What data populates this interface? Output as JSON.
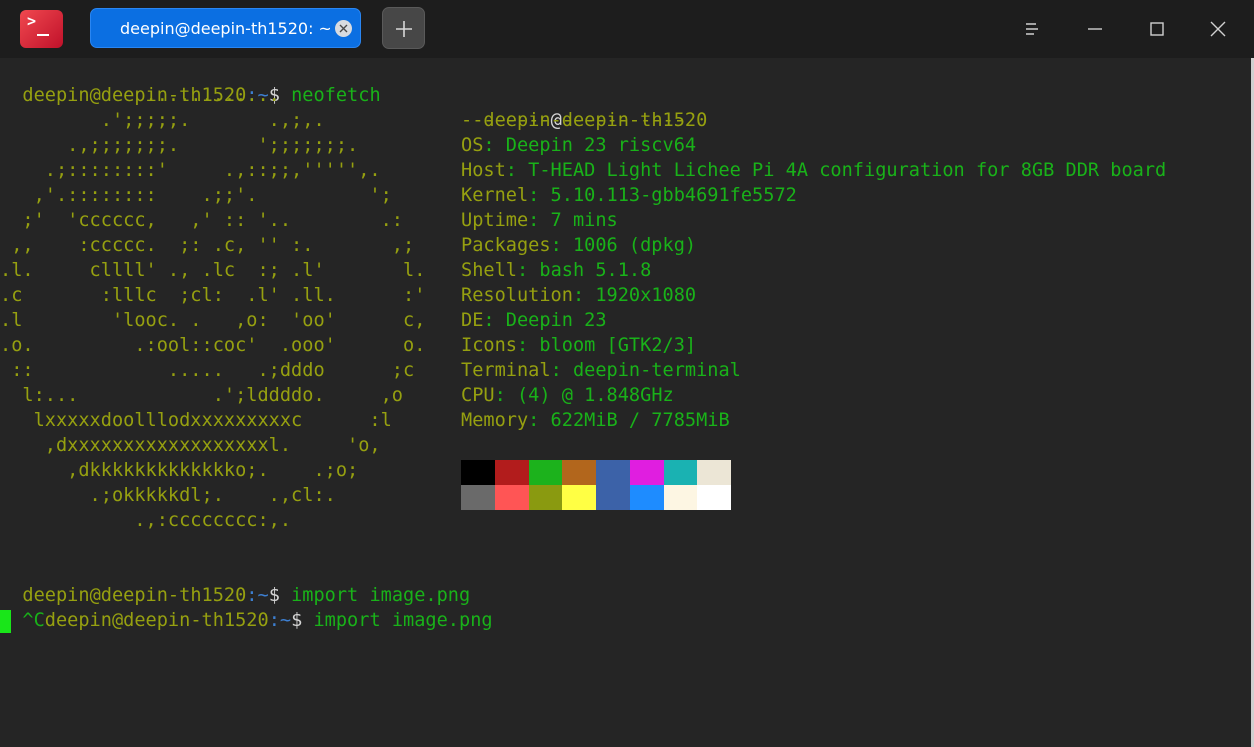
{
  "window": {
    "tab_title": "deepin@deepin-th1520: ~",
    "new_tab_label": "+"
  },
  "session": {
    "user": "deepin",
    "at": "@",
    "host": "deepin-th1520",
    "path_sep": ":~",
    "dollar": "$",
    "cmd1": " neofetch",
    "cmd2": " import image.png",
    "cmd3": " import image.png",
    "ctrl_c": "^C"
  },
  "logo_lines": [
    "             ............",
    "         .';;;;;.       .,;,.",
    "      .,;;;;;;;.       ';;;;;;;.",
    "    .;::::::::'     .,::;;,''''',.",
    "   ,'.::::::::    .;;'.          ';",
    "  ;'  'cccccc,   ,' :: '..        .:",
    " ,,    :ccccc.  ;: .c, '' :.       ,;",
    ".l.     cllll' ., .lc  :; .l'       l.",
    ".c       :lllc  ;cl:  .l' .ll.      :'",
    ".l        'looc. .   ,o:  'oo'      c,",
    ".o.         .:ool::coc'  .ooo'      o.",
    " ::            .....   .;dddo      ;c",
    "  l:...            .';lddddo.     ,o",
    "   lxxxxxdoolllodxxxxxxxxxc      :l",
    "    ,dxxxxxxxxxxxxxxxxxxl.     'o,",
    "      ,dkkkkkkkkkkkkko;.    .;o;",
    "        .;okkkkkdl;.    .,cl:.",
    "            .,:cccccccc:,."
  ],
  "info": {
    "header_user": "deepin",
    "header_at": "@",
    "header_host": "deepin-th1520",
    "separator": "--------------------",
    "rows": [
      {
        "key": "OS",
        "value": ": Deepin 23 riscv64"
      },
      {
        "key": "Host",
        "value": ": T-HEAD Light Lichee Pi 4A configuration for 8GB DDR board"
      },
      {
        "key": "Kernel",
        "value": ": 5.10.113-gbb4691fe5572"
      },
      {
        "key": "Uptime",
        "value": ": 7 mins"
      },
      {
        "key": "Packages",
        "value": ": 1006 (dpkg)"
      },
      {
        "key": "Shell",
        "value": ": bash 5.1.8"
      },
      {
        "key": "Resolution",
        "value": ": 1920x1080"
      },
      {
        "key": "DE",
        "value": ": Deepin 23"
      },
      {
        "key": "Icons",
        "value": ": bloom [GTK2/3]"
      },
      {
        "key": "Terminal",
        "value": ": deepin-terminal"
      },
      {
        "key": "CPU",
        "value": ": (4) @ 1.848GHz"
      },
      {
        "key": "Memory",
        "value": ": 622MiB / 7785MiB"
      }
    ]
  },
  "palette": {
    "top": [
      "#000000",
      "#b21c1c",
      "#1cb21c",
      "#b2661c",
      "#3c62a8",
      "#e01ee0",
      "#1ab2b2",
      "#ece6d6"
    ],
    "bottom": [
      "#6a6a6a",
      "#ff5555",
      "#8a9a10",
      "#ffff44",
      "#3c62a8",
      "#1e8cff",
      "#fdf6e3",
      "#ffffff"
    ]
  }
}
